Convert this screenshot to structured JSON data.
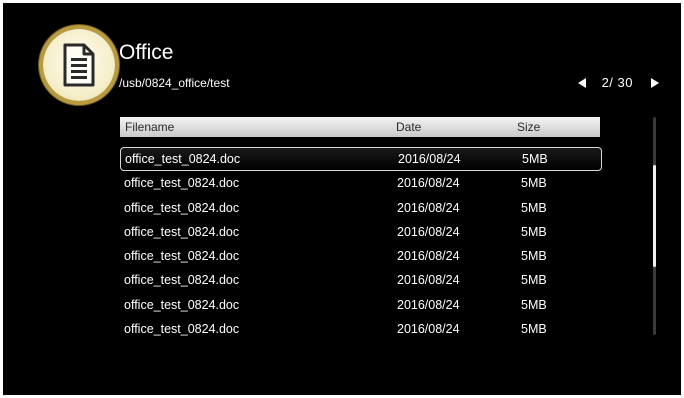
{
  "app": {
    "title": "Office",
    "path": "/usb/0824_office/test",
    "icon": "document-icon"
  },
  "pager": {
    "text": "2/ 30"
  },
  "table": {
    "columns": [
      "Filename",
      "Date",
      "Size"
    ],
    "rows": [
      {
        "filename": "office_test_0824.doc",
        "date": "2016/08/24",
        "size": "5MB"
      },
      {
        "filename": "office_test_0824.doc",
        "date": "2016/08/24",
        "size": "5MB"
      },
      {
        "filename": "office_test_0824.doc",
        "date": "2016/08/24",
        "size": "5MB"
      },
      {
        "filename": "office_test_0824.doc",
        "date": "2016/08/24",
        "size": "5MB"
      },
      {
        "filename": "office_test_0824.doc",
        "date": "2016/08/24",
        "size": "5MB"
      },
      {
        "filename": "office_test_0824.doc",
        "date": "2016/08/24",
        "size": "5MB"
      },
      {
        "filename": "office_test_0824.doc",
        "date": "2016/08/24",
        "size": "5MB"
      },
      {
        "filename": "office_test_0824.doc",
        "date": "2016/08/24",
        "size": "5MB"
      }
    ],
    "selected_index": 0
  },
  "colors": {
    "background": "#000000",
    "text": "#ffffff",
    "icon_ring": "#b99a3e"
  }
}
